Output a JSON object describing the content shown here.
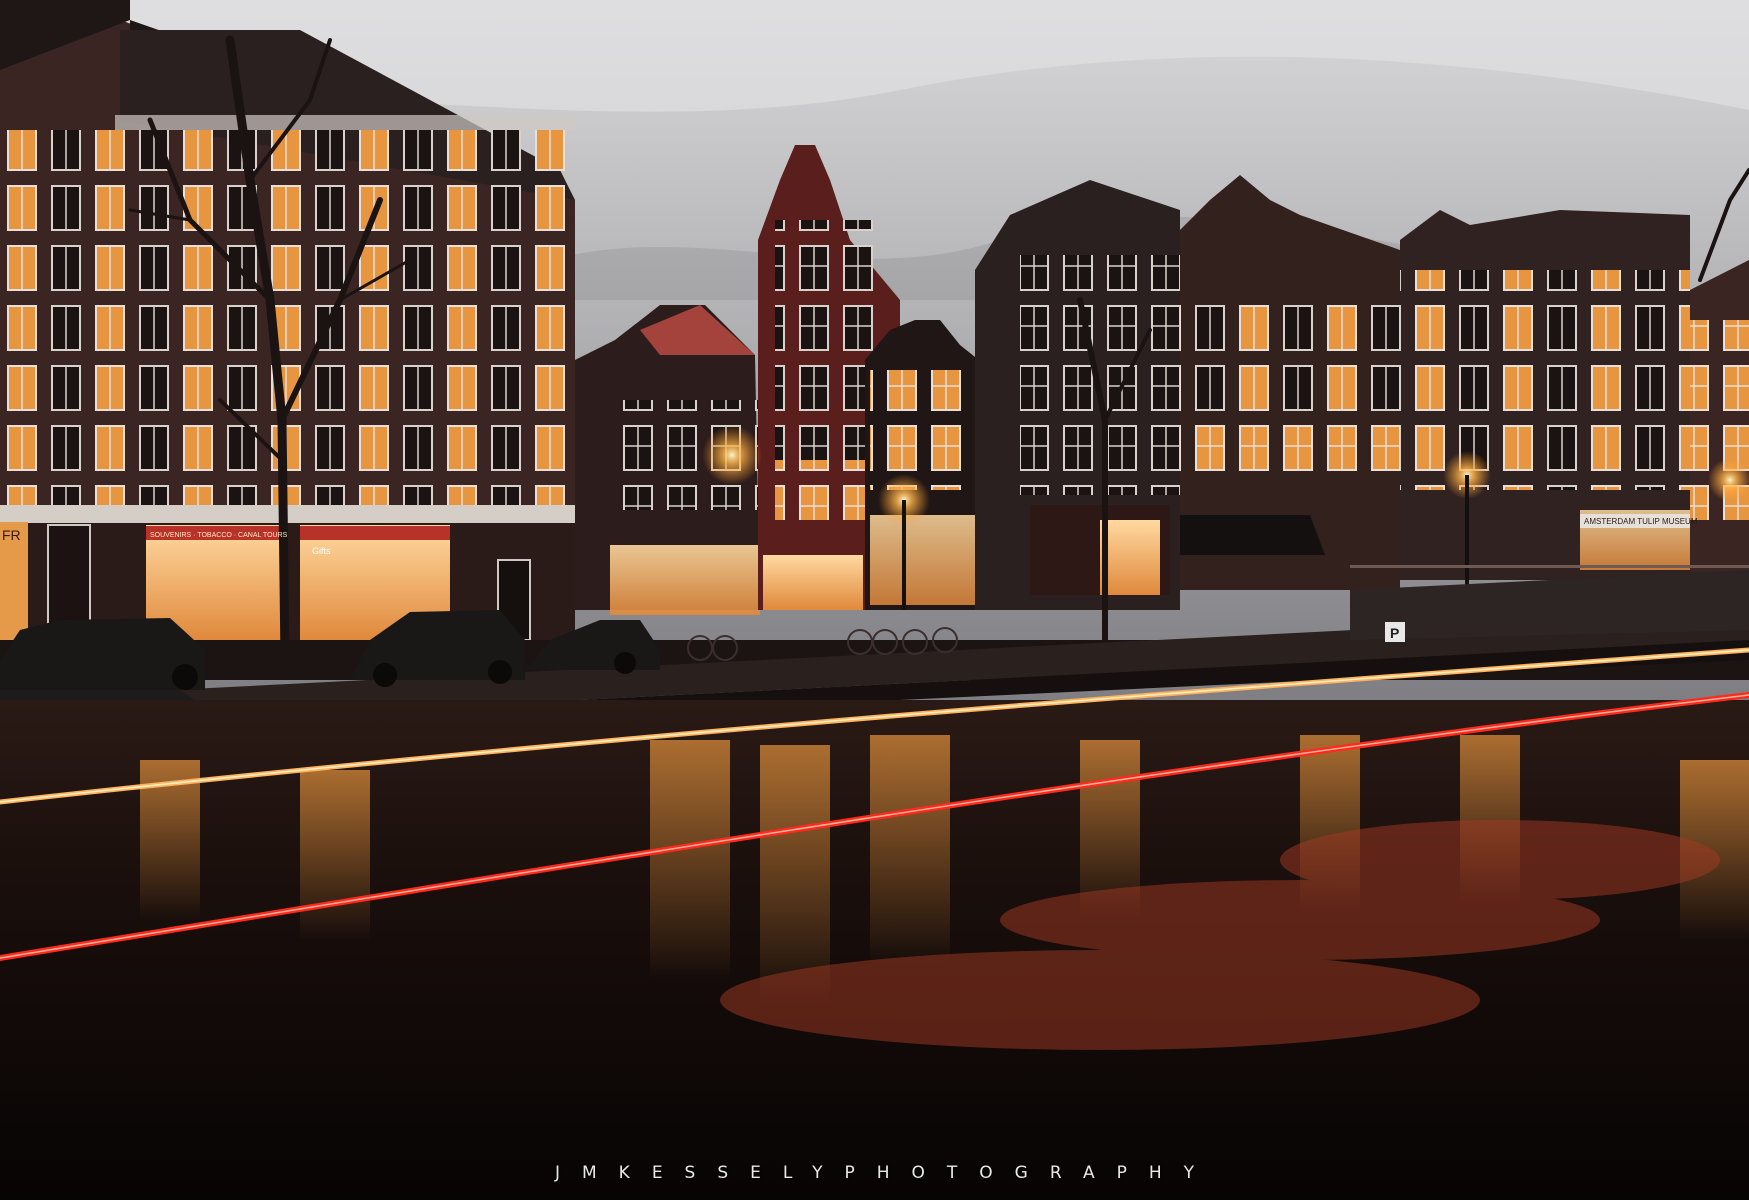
{
  "photo": {
    "watermark": "JMKESSELYPHOTOGRAPHY",
    "signs": {
      "museum": "AMSTERDAM TULIP MUSEUM",
      "gifts": "Gifts",
      "souvenir_banner": "SOUVENIRS · TOBACCO · CANAL TOURS",
      "left_shop": "FR",
      "parking": "P"
    }
  },
  "colors": {
    "sky_top": "#d9d9db",
    "sky_bottom": "#8f8f93",
    "brick": "#3b2522",
    "dark_brick": "#241817",
    "red_brick": "#5d1f1d",
    "window_glow": "#f3a64a",
    "water": "#150c0a",
    "light_trail_orange": "#ffb35c",
    "light_trail_red": "#ff2a1a"
  }
}
